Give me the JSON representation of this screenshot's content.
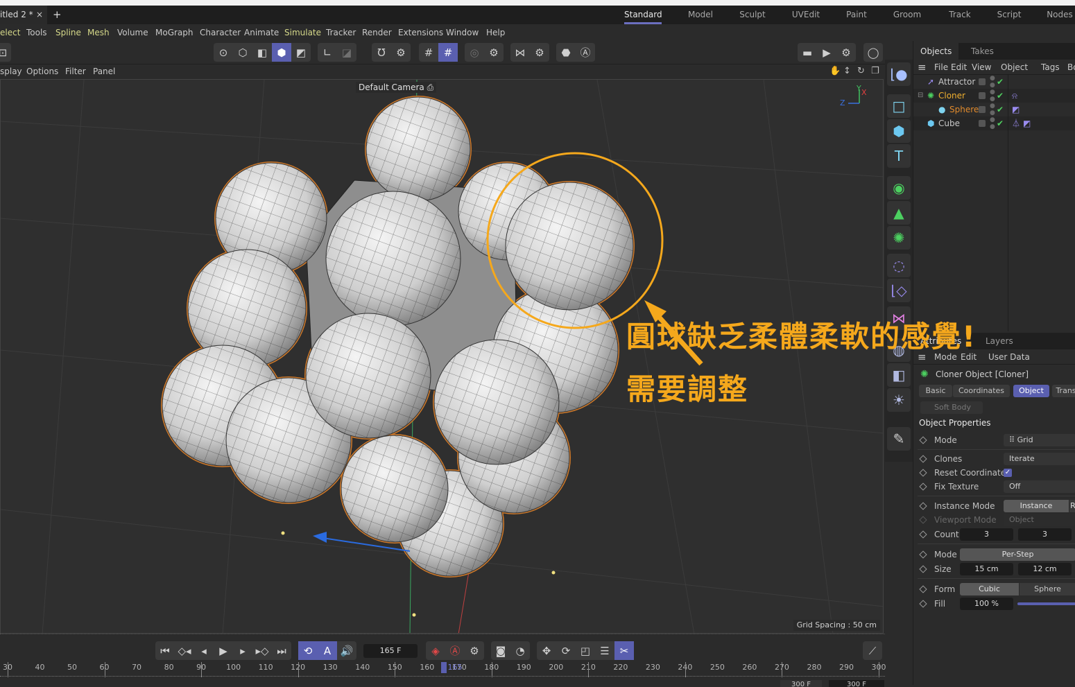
{
  "window": {
    "doc_tab": "itled 2 *",
    "close_glyph": "×",
    "add_glyph": "+"
  },
  "layouts": [
    {
      "label": "Standard",
      "active": true
    },
    {
      "label": "Model"
    },
    {
      "label": "Sculpt"
    },
    {
      "label": "UVEdit"
    },
    {
      "label": "Paint"
    },
    {
      "label": "Groom"
    },
    {
      "label": "Track"
    },
    {
      "label": "Script"
    },
    {
      "label": "Nodes"
    }
  ],
  "menu": [
    "elect",
    "Tools",
    "Spline",
    "Mesh",
    "Volume",
    "MoGraph",
    "Character",
    "Animate",
    "Simulate",
    "Tracker",
    "Render",
    "Extensions",
    "Window",
    "Help"
  ],
  "viewport_menu": [
    "splay",
    "Options",
    "Filter",
    "Panel"
  ],
  "viewport": {
    "camera_label": "Default Camera",
    "grid_spacing": "Grid Spacing : 50 cm",
    "axis": {
      "x": "X",
      "y": "Y",
      "z": "Z"
    }
  },
  "annotation": {
    "line1": "圓球缺乏柔體柔軟的感覺!",
    "line2": "需要調整",
    "color": "#f5a81c"
  },
  "objects_panel": {
    "tabs": [
      "Objects",
      "Takes"
    ],
    "menu": [
      "File",
      "Edit",
      "View",
      "Object",
      "Tags",
      "Bo"
    ],
    "items": [
      {
        "name": "Attractor",
        "icon": "attractor-icon",
        "color": "#c8c8c8",
        "tags": []
      },
      {
        "name": "Cloner",
        "icon": "cloner-icon",
        "color": "#f0b030",
        "tags": [
          "dynamics-body-tag-icon"
        ]
      },
      {
        "name": "Sphere",
        "icon": "sphere-icon",
        "color": "#e08a2c",
        "tags": [
          "phong-tag-icon"
        ]
      },
      {
        "name": "Cube",
        "icon": "cube-icon",
        "color": "#c8c8c8",
        "tags": [
          "cloth-hanger-tag-icon",
          "phong-tag-icon"
        ]
      }
    ]
  },
  "attributes_panel": {
    "tabs": [
      "Attributes",
      "Layers"
    ],
    "menu": [
      "Mode",
      "Edit",
      "User Data"
    ],
    "object_title": "Cloner Object [Cloner]",
    "subtabs": [
      {
        "label": "Basic"
      },
      {
        "label": "Coordinates"
      },
      {
        "label": "Object",
        "active": true
      },
      {
        "label": "Trans"
      }
    ],
    "hidden_row": "Soft Body",
    "section_title": "Object Properties",
    "rows": {
      "mode": {
        "label": "Mode",
        "value": "Grid"
      },
      "clones": {
        "label": "Clones",
        "value": "Iterate"
      },
      "reset_coordinates": {
        "label": "Reset Coordinates",
        "checked": true
      },
      "fix_texture": {
        "label": "Fix Texture",
        "value": "Off"
      },
      "instance_mode": {
        "label": "Instance Mode",
        "value": "Instance",
        "next": "R"
      },
      "viewport_mode": {
        "label": "Viewport Mode",
        "value": "Object"
      },
      "count": {
        "label": "Count",
        "x": "3",
        "y": "3"
      },
      "step_mode": {
        "label": "Mode",
        "value": "Per-Step"
      },
      "size": {
        "label": "Size",
        "x": "15 cm",
        "y": "12 cm"
      },
      "form": {
        "label": "Form",
        "options": [
          "Cubic",
          "Sphere"
        ],
        "selected": "Cubic"
      },
      "fill": {
        "label": "Fill",
        "value": "100 %",
        "fraction": 1.0
      }
    }
  },
  "timeline": {
    "current_frame": "165 F",
    "playhead_label": "165",
    "end_frame_a": "300 F",
    "end_frame_b": "300 F",
    "ticks": [
      "30",
      "40",
      "50",
      "60",
      "70",
      "80",
      "90",
      "100",
      "110",
      "120",
      "130",
      "140",
      "150",
      "160",
      "170",
      "180",
      "190",
      "200",
      "210",
      "220",
      "230",
      "240",
      "250",
      "260",
      "270",
      "280",
      "290",
      "300"
    ]
  }
}
